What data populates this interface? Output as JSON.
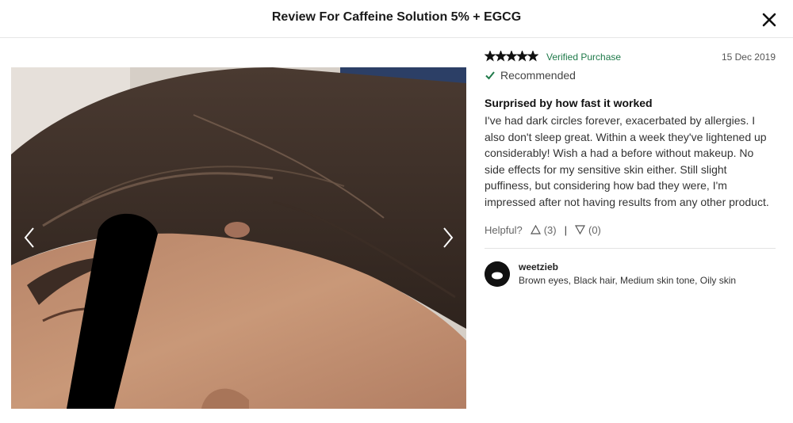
{
  "modal": {
    "title": "Review For Caffeine Solution 5% + EGCG",
    "close_icon": "close-icon"
  },
  "photo": {
    "description_icon": "review-photo",
    "prev_icon": "chevron-left-icon",
    "next_icon": "chevron-right-icon"
  },
  "review": {
    "rating": 5,
    "rating_max": 5,
    "verified": "Verified Purchase",
    "date": "15 Dec 2019",
    "recommended": "Recommended",
    "headline": "Surprised by how fast it worked",
    "body": "I've had dark circles forever, exacerbated by allergies. I also don't sleep great. Within a week they've lightened up considerably! Wish a had a before without makeup. No side effects for my sensitive skin either. Still slight puffiness, but considering how bad they were, I'm impressed after not having results from any other product.",
    "helpful_label": "Helpful?",
    "helpful_yes": "(3)",
    "helpful_separator": "|",
    "helpful_no": "(0)"
  },
  "author": {
    "name": "weetzieb",
    "traits": "Brown eyes, Black hair, Medium skin tone, Oily skin"
  },
  "colors": {
    "verified": "#1f7a4a",
    "star": "#111111"
  }
}
